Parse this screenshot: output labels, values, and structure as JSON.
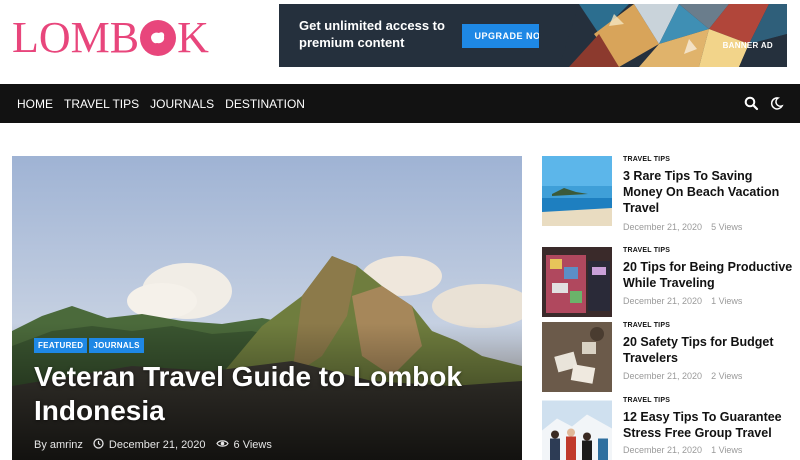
{
  "header": {
    "logo_text_left": "LOMB",
    "logo_text_right": "K",
    "brand_color": "#e8467c"
  },
  "banner": {
    "text": "Get unlimited access to premium content",
    "button_label": "UPGRADE NOW",
    "label": "BANNER AD"
  },
  "nav": {
    "items": [
      "HOME",
      "TRAVEL TIPS",
      "JOURNALS",
      "DESTINATION"
    ],
    "search_icon": "search-icon",
    "theme_icon": "moon-icon"
  },
  "featured": {
    "tags": [
      "FEATURED",
      "JOURNALS"
    ],
    "title": "Veteran Travel Guide to Lombok Indonesia",
    "by_label": "By",
    "author": "amrinz",
    "date": "December 21, 2020",
    "views": "6 Views"
  },
  "posts": [
    {
      "category": "TRAVEL TIPS",
      "title": "3 Rare Tips To Saving Money On Beach Vacation Travel",
      "date": "December 21, 2020",
      "views": "5 Views"
    },
    {
      "category": "TRAVEL TIPS",
      "title": "20 Tips for Being Productive While Traveling",
      "date": "December 21, 2020",
      "views": "1 Views"
    },
    {
      "category": "TRAVEL TIPS",
      "title": "20 Safety Tips for Budget Travelers",
      "date": "December 21, 2020",
      "views": "2 Views"
    },
    {
      "category": "TRAVEL TIPS",
      "title": "12 Easy Tips To Guarantee Stress Free Group Travel",
      "date": "December 21, 2020",
      "views": "1 Views"
    }
  ],
  "colors": {
    "accent": "#1e88e5",
    "nav_bg": "#121212",
    "banner_bg": "#25303d"
  }
}
